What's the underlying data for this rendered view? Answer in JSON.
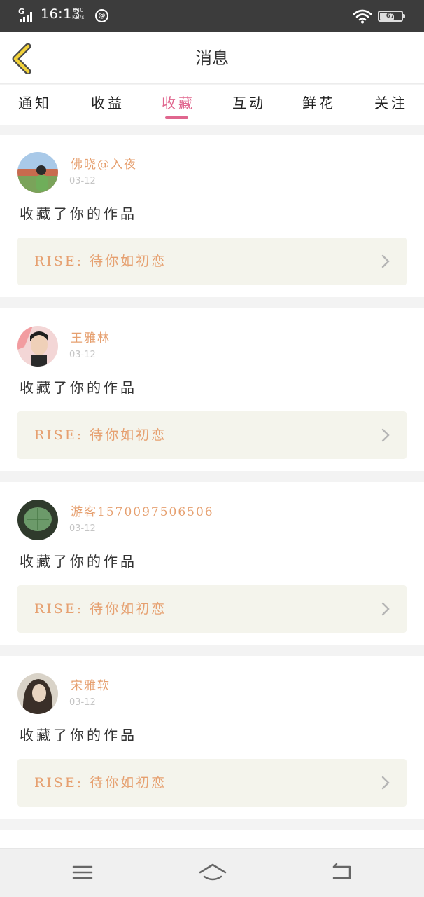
{
  "status_bar": {
    "network": "G",
    "time": "16:13",
    "speed_value": "840",
    "speed_unit": "KB/s",
    "notification_icon": "@",
    "battery": "67",
    "battery_level": 0.67
  },
  "header": {
    "title": "消息",
    "back_icon": "chevron-left-icon"
  },
  "tabs": [
    {
      "label": "通知"
    },
    {
      "label": "收益"
    },
    {
      "label": "收藏"
    },
    {
      "label": "互动"
    },
    {
      "label": "鲜花"
    },
    {
      "label": "关注"
    }
  ],
  "active_tab": "收藏",
  "colors": {
    "accent": "#e0668e",
    "name_orange": "#e6a070",
    "work_bg": "#f4f4ec"
  },
  "messages": [
    {
      "user": "佛晓@入夜",
      "date": "03-12",
      "action": "收藏了你的作品",
      "work": "RISE: 待你如初恋"
    },
    {
      "user": "王雅林",
      "date": "03-12",
      "action": "收藏了你的作品",
      "work": "RISE: 待你如初恋"
    },
    {
      "user": "游客15700975065​06",
      "date": "03-12",
      "action": "收藏了你的作品",
      "work": "RISE: 待你如初恋"
    },
    {
      "user": "宋雅软",
      "date": "03-12",
      "action": "收藏了你的作品",
      "work": "RISE: 待你如初恋"
    }
  ],
  "nav": {
    "menu_icon": "menu-icon",
    "home_icon": "home-icon",
    "back_icon": "back-icon"
  }
}
